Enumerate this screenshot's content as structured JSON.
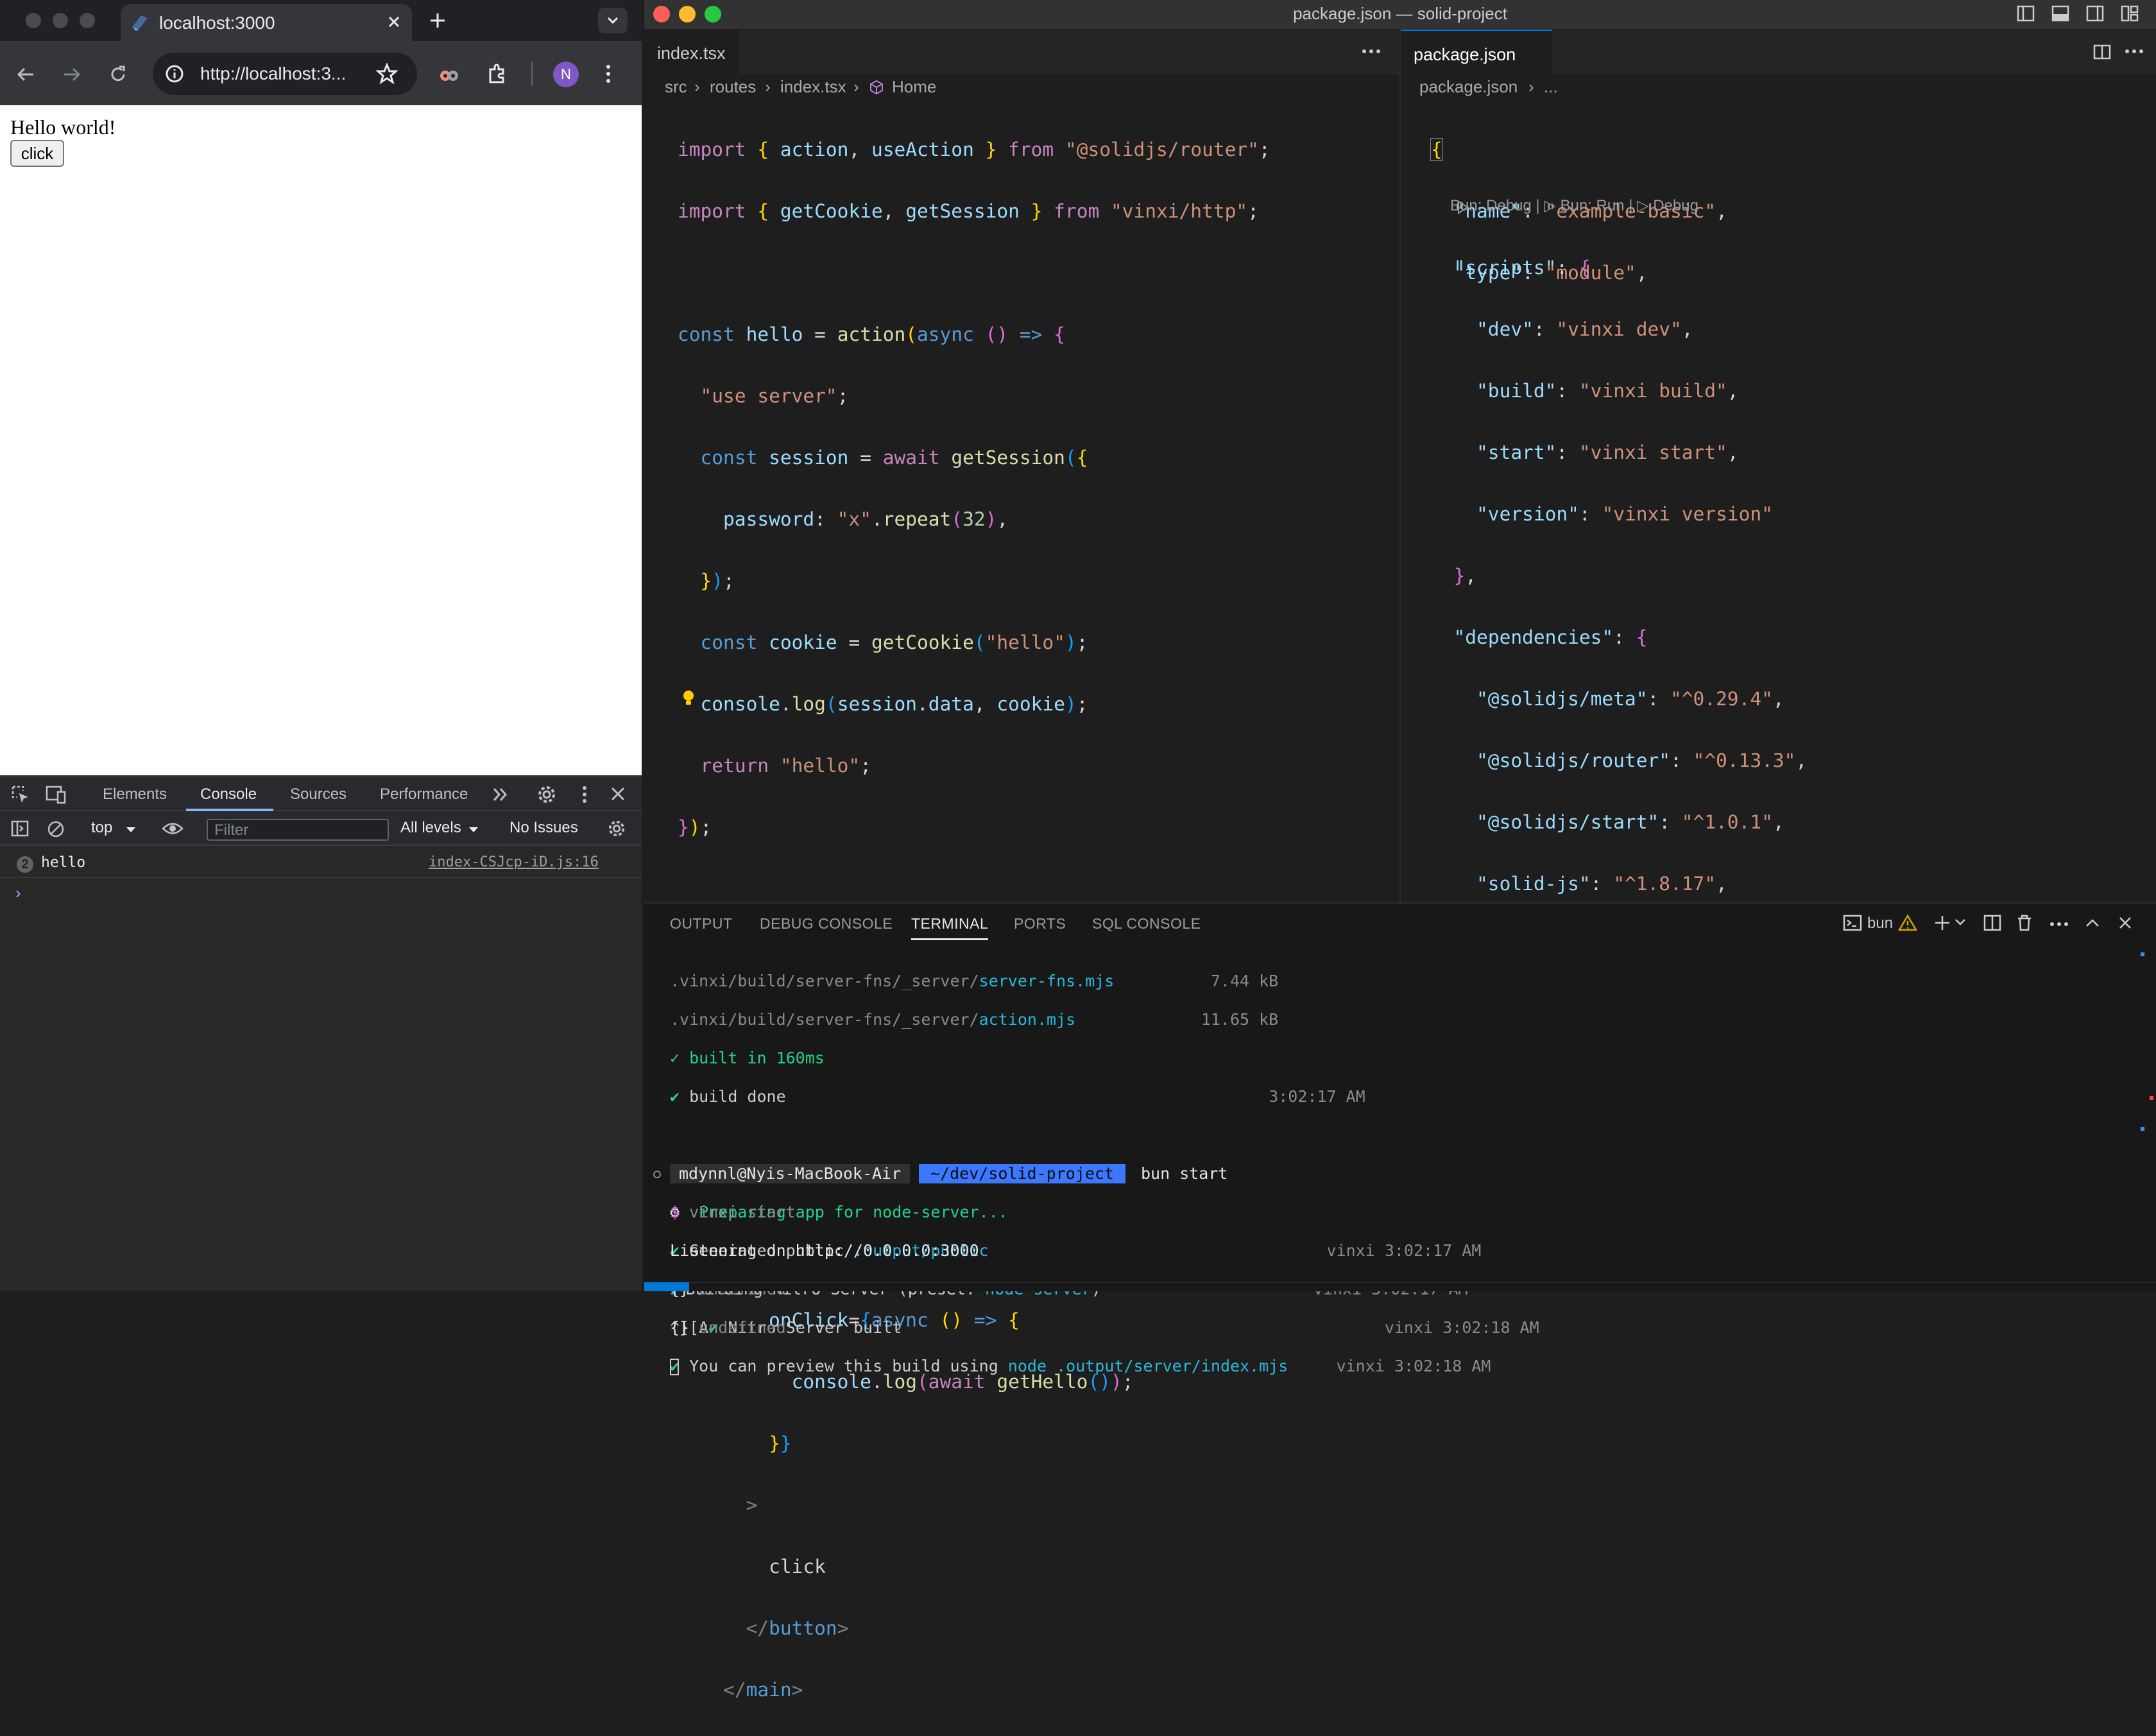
{
  "browser": {
    "tab_title": "localhost:3000",
    "url": "http://localhost:3...",
    "profile_initial": "N",
    "page": {
      "heading": "Hello world!",
      "button_label": "click"
    },
    "devtools": {
      "tabs": [
        "Elements",
        "Console",
        "Sources",
        "Performance"
      ],
      "active_tab": "Console",
      "context": "top",
      "filter_placeholder": "Filter",
      "levels": "All levels",
      "issues": "No Issues",
      "log": {
        "count": "2",
        "message": "hello",
        "source": "index-CSJcp-iD.js:16"
      },
      "prompt": "›"
    }
  },
  "vscode": {
    "window_title": "package.json — solid-project",
    "left_editor": {
      "tab": "index.tsx",
      "breadcrumb": [
        "src",
        "routes",
        "index.tsx",
        "Home"
      ]
    },
    "right_editor": {
      "tab": "package.json",
      "breadcrumb": [
        "package.json",
        "..."
      ],
      "codelens": "Bun: Debug | ▷ Bun: Run | ▷ Debug"
    },
    "panel": {
      "tabs": [
        "OUTPUT",
        "DEBUG CONSOLE",
        "TERMINAL",
        "PORTS",
        "SQL CONSOLE"
      ],
      "active_tab": "TERMINAL",
      "shell_name": "bun",
      "prompt_user": "mdynnl@Nyis-MacBook-Air",
      "prompt_path": "~/dev/solid-project",
      "prompt_cmd": "bun start"
    }
  }
}
